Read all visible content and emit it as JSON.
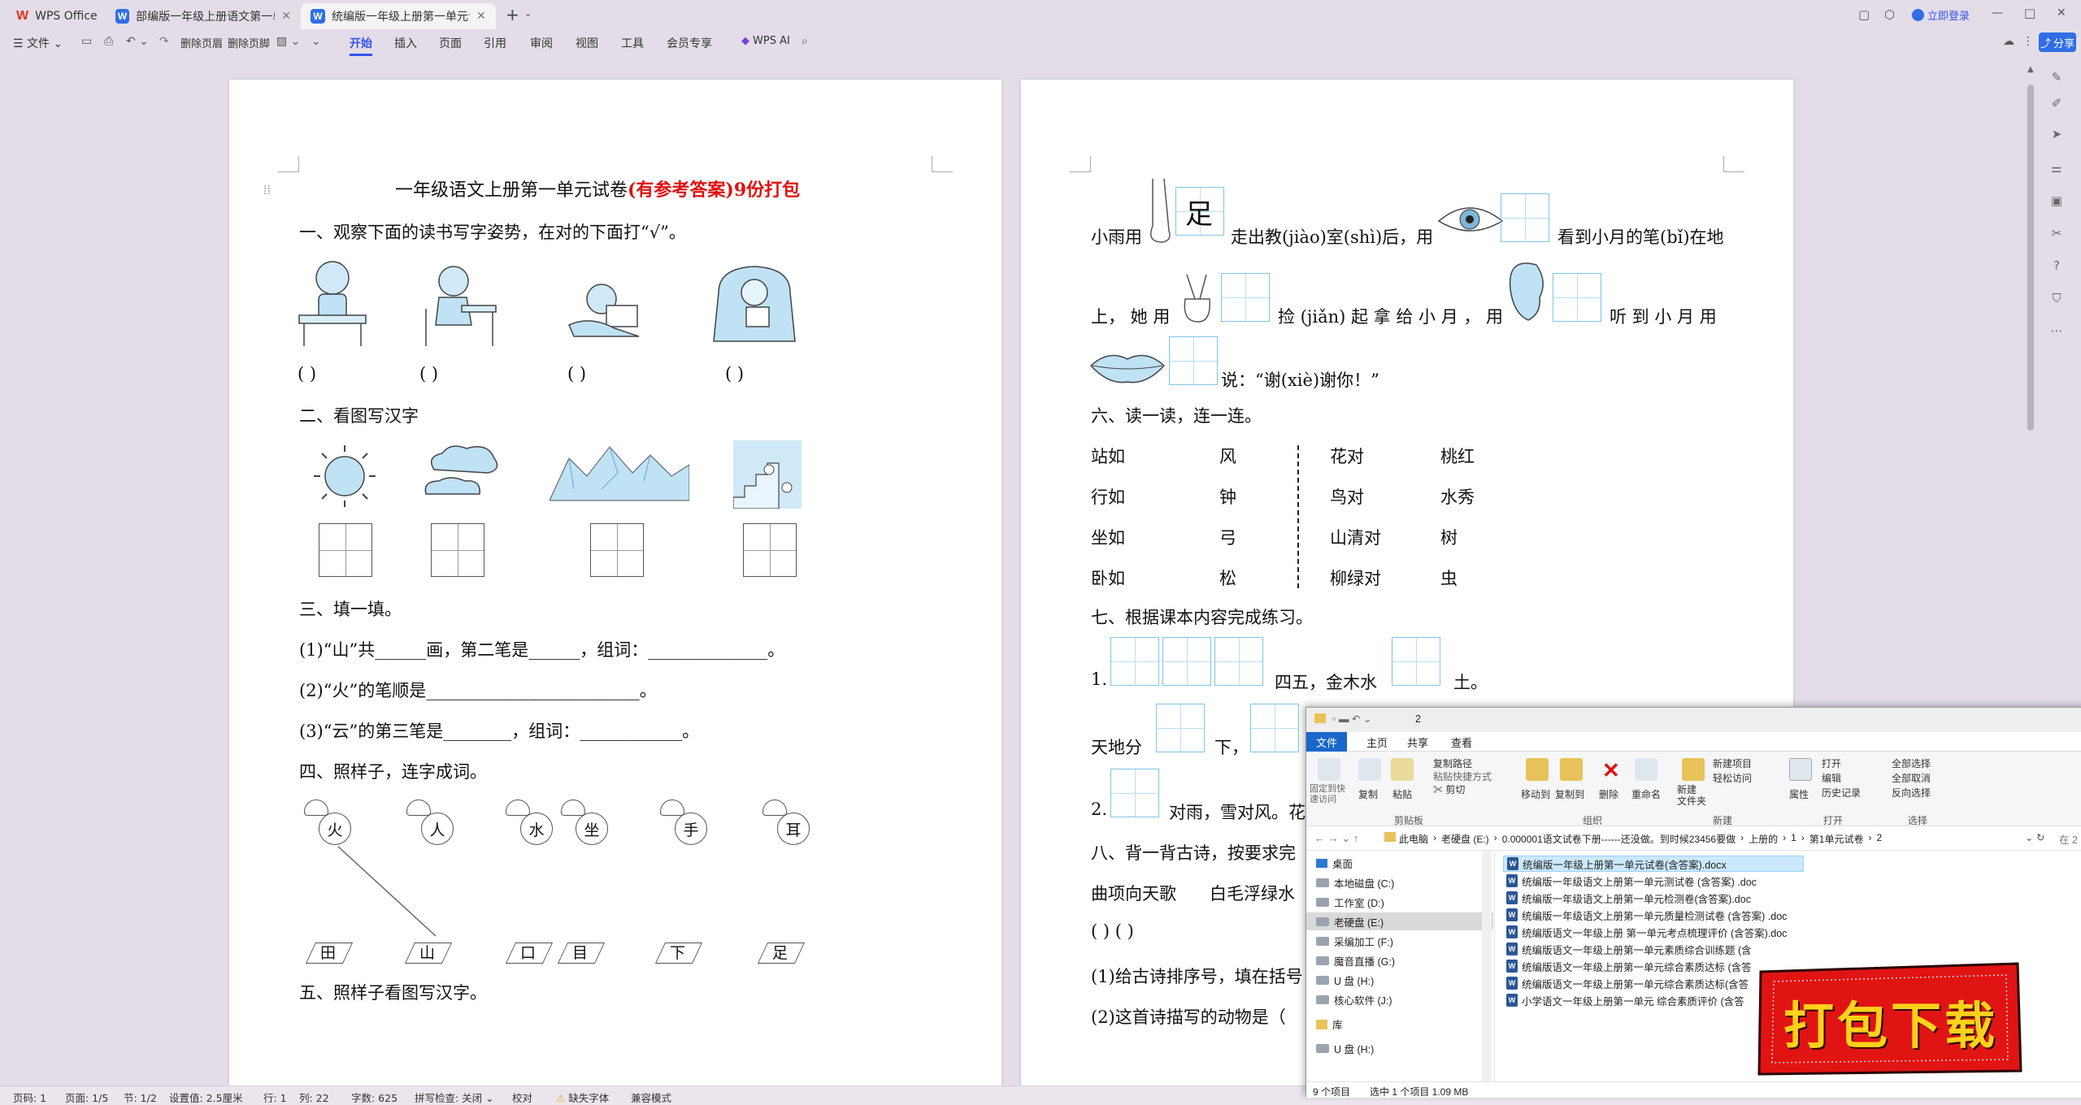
{
  "tabs": [
    {
      "label": "WPS Office"
    },
    {
      "label": "部编版一年级上册语文第一单元测"
    },
    {
      "label": "统编版一年级上册第一单元试"
    }
  ],
  "window": {
    "login_label": "立即登录",
    "minimize": "—",
    "maximize": "□",
    "close": "✕"
  },
  "toolbar": {
    "file_label": "文件",
    "delete_header": "删除页眉",
    "delete_footer": "删除页脚",
    "menu_tabs": [
      "开始",
      "插入",
      "页面",
      "引用",
      "审阅",
      "视图",
      "工具",
      "会员专享"
    ],
    "active_tab": "开始",
    "ai_label": "WPS AI",
    "share_label": "分享"
  },
  "page1": {
    "title_prefix": "一年级语文上册第一单元试卷",
    "title_suffix": "(有参考答案)9份打包",
    "q1": "一、观察下面的读书写字姿势，在对的下面打“√”。",
    "paren": "(        )",
    "q2": "二、看图写汉字",
    "q3": "三、填一填。",
    "q3_1": "(1)“山”共______画，第二笔是______，组词：______________。",
    "q3_2": "(2)“火”的笔顺是_________________________。",
    "q3_3": "(3)“云”的第三笔是________，组词：____________。",
    "q4": "四、照样子，连字成词。",
    "top_chars": [
      "火",
      "人",
      "水",
      "坐",
      "手",
      "耳"
    ],
    "bottom_chars": [
      "田",
      "山",
      "口",
      "目",
      "下",
      "足"
    ],
    "q5": "五、照样子看图写汉字。"
  },
  "page2": {
    "line1_a": "小雨用",
    "foot_char": "足",
    "line1_b": "走出教(jiào)室(shì)后，用",
    "line1_c": "看到小月的笔(bǐ)在地",
    "line2_a": "上， 她 用",
    "line2_b": "捡 (jiǎn) 起 拿 给 小 月 ，  用",
    "line2_c": "听 到 小 月 用",
    "line3": "说：“谢(xiè)谢你！”",
    "q6": "六、读一读，连一连。",
    "col1": [
      "站如",
      "行如",
      "坐如",
      "卧如"
    ],
    "col2": [
      "风",
      "钟",
      "弓",
      "松"
    ],
    "col3": [
      "花对",
      "鸟对",
      "山清对",
      "柳绿对"
    ],
    "col4": [
      "桃红",
      "水秀",
      "树",
      "虫"
    ],
    "q7": "七、根据课本内容完成练习。",
    "q7_1a": "1.",
    "q7_1b": "四五，金木水",
    "q7_1c": "土。",
    "q7_2a": "天地分",
    "q7_2b": "下，",
    "q7_3a": "2.",
    "q7_3b": "对雨，雪对风。花",
    "q8": "八、背一背古诗，按要求完",
    "poem1": "曲项向天歌",
    "poem2": "白毛浮绿水",
    "parens": "(        )          (        )",
    "q8_1": "(1)给古诗排序号，填在括号",
    "q8_2": "(2)这首诗描写的动物是（"
  },
  "explorer": {
    "title_num": "2",
    "tabs": [
      "文件",
      "主页",
      "共享",
      "查看"
    ],
    "ribbon": {
      "pin": "固定到快\n速访问",
      "copy": "复制",
      "paste": "粘贴",
      "copy_path": "复制路径",
      "paste_shortcut": "粘贴快捷方式",
      "cut": "剪切",
      "move_to": "移动到",
      "copy_to": "复制到",
      "delete": "删除",
      "rename": "重命名",
      "new_folder": "新建\n文件夹",
      "new_item": "新建项目",
      "easy_access": "轻松访问",
      "properties": "属性",
      "open": "打开",
      "edit": "编辑",
      "history": "历史记录",
      "select_all": "全部选择",
      "select_none": "全部取消",
      "invert": "反向选择",
      "group_clipboard": "剪贴板",
      "group_organize": "组织",
      "group_new": "新建",
      "group_open": "打开",
      "group_select": "选择"
    },
    "breadcrumb": [
      "此电脑",
      "老硬盘 (E:)",
      "0.000001语文试卷下册------还没做。到时候23456要做",
      "上册的",
      "1",
      "第1单元试卷",
      "2"
    ],
    "search_placeholder": "在 2",
    "nav": [
      "桌面",
      "本地磁盘 (C:)",
      "工作室 (D:)",
      "老硬盘 (E:)",
      "采编加工 (F:)",
      "魔音直播 (G:)",
      "U 盘 (H:)",
      "核心软件 (J:)",
      "库",
      "U 盘 (H:)"
    ],
    "files": [
      "统编版一年级上册第一单元试卷(含答案).docx",
      "统编版一年级语文上册第一单元测试卷 (含答案) .doc",
      "统编版一年级语文上册第一单元检测卷(含答案).doc",
      "统编版一年级语文上册第一单元质量检测试卷 (含答案) .doc",
      "统编版语文一年级上册 第一单元考点梳理评价 (含答案).doc",
      "统编版语文一年级上册第一单元素质综合训练题 (含",
      "统编版语文一年级上册第一单元综合素质达标 (含答",
      "统编版语文一年级上册第一单元综合素质达标(含答",
      "小学语文一年级上册第一单元 综合素质评价 (含答"
    ],
    "status_count": "9 个项目",
    "status_selected": "选中 1 个项目  1.09 MB"
  },
  "banner": {
    "text": "打包下载"
  },
  "statusbar": {
    "page": "页码: 1",
    "pages": "页面: 1/5",
    "section": "节: 1/2",
    "setting": "设置值: 2.5厘米",
    "row": "行: 1",
    "col": "列: 22",
    "words": "字数: 625",
    "spell": "拼写检查: 关闭",
    "proof": "校对",
    "missing_font": "缺失字体",
    "compat": "兼容模式"
  }
}
